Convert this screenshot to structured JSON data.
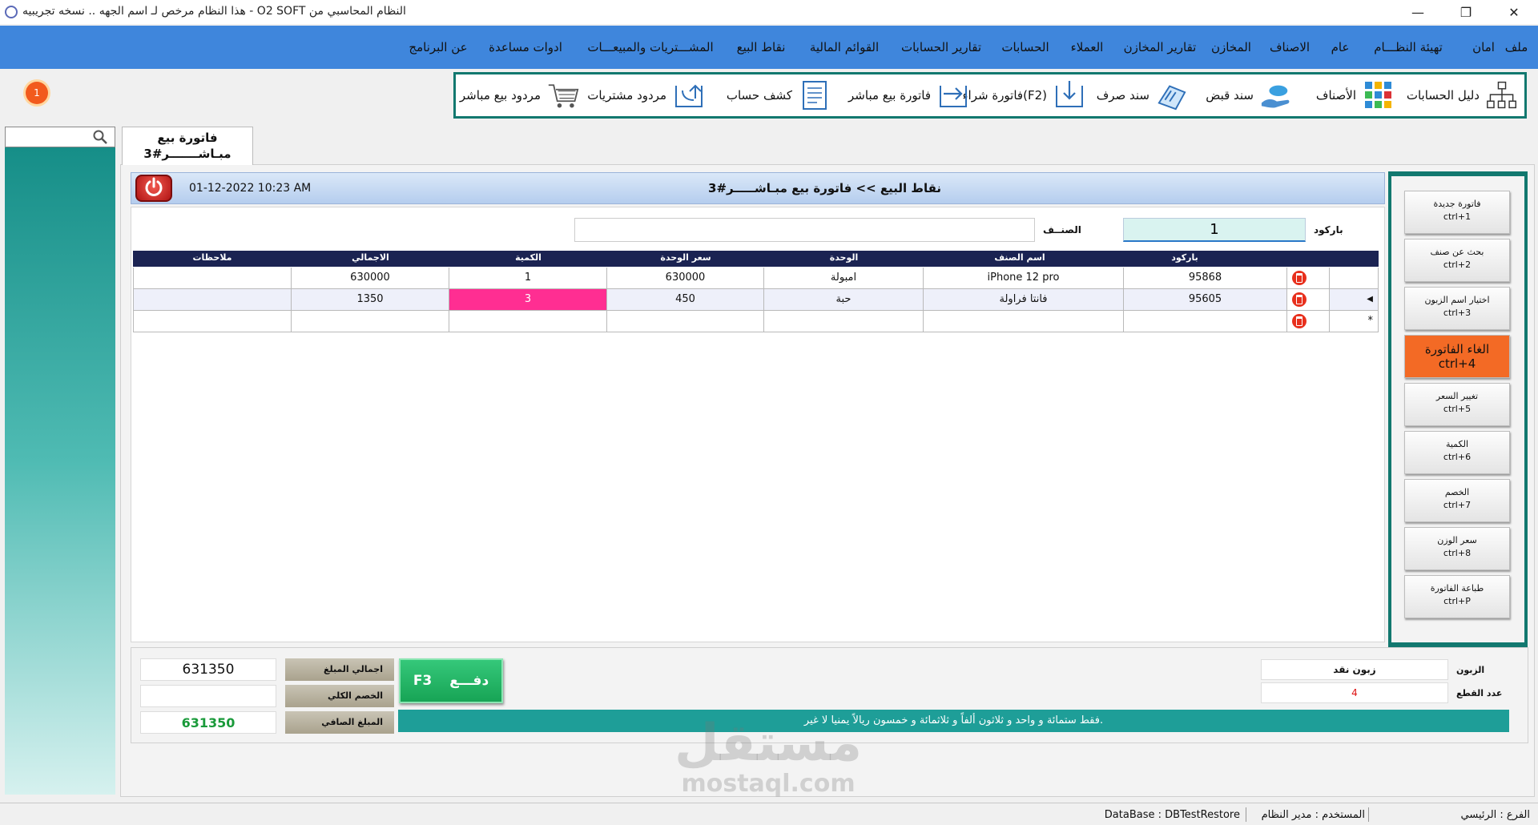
{
  "window": {
    "title": "النظام المحاسبي من O2 SOFT - هذا النظام مرخص لـ اسم الجهه .. نسخه تجريبيه",
    "minimize": "—",
    "restore": "❐",
    "close": "✕"
  },
  "menu": [
    "ملف",
    "امان",
    "تهيئة النظـــام",
    "عام",
    "الاصناف",
    "المخازن",
    "تقارير المخازن",
    "العملاء",
    "الحسابات",
    "تقارير الحسابات",
    "القوائم المالية",
    "نقاط البيع",
    "المشـــتريات والمبيعـــات",
    "ادوات مساعدة",
    "عن البرنامج"
  ],
  "toolbar": [
    {
      "label": "دليل الحسابات",
      "icon": "account-tree-icon"
    },
    {
      "label": "الأصناف",
      "icon": "items-grid-icon"
    },
    {
      "label": "سند قبض",
      "icon": "receipt-hand-icon"
    },
    {
      "label": "سند صرف",
      "icon": "payment-note-icon"
    },
    {
      "label": "فاتورة شراء(F2)",
      "icon": "purchase-invoice-icon"
    },
    {
      "label": "فاتورة بيع مباشر",
      "icon": "sales-invoice-icon"
    },
    {
      "label": "كشف حساب",
      "icon": "statement-icon"
    },
    {
      "label": "مردود مشتريات",
      "icon": "purchase-return-icon"
    },
    {
      "label": "مردود بيع مباشر",
      "icon": "cart-return-icon"
    }
  ],
  "notifications": {
    "count": "1"
  },
  "doc_tab": {
    "line1": "فاتورة  بيع",
    "line2": "مبـاشـــــــر#3"
  },
  "invoice": {
    "datetime": "01-12-2022 10:23 AM",
    "title": "نقاط البيع >> فاتورة بيع مبـاشـــــر#3",
    "barcode_label": "باركود",
    "barcode_value": "1",
    "category_label": "الصنــف",
    "category_value": ""
  },
  "grid": {
    "headers": {
      "barcode": "باركود",
      "item_name": "اسم الصنف",
      "unit": "الوحدة",
      "unit_price": "سعر الوحدة",
      "qty": "الكمية",
      "total": "الاجمالي",
      "notes": "ملاحظات"
    },
    "rows": [
      {
        "marker": "",
        "barcode": "95868",
        "item_name": "iPhone 12 pro",
        "unit": "امبولة",
        "unit_price": "630000",
        "qty": "1",
        "total": "630000",
        "notes": ""
      },
      {
        "marker": "◀",
        "barcode": "95605",
        "item_name": "فانتا فراولة",
        "unit": "حبة",
        "unit_price": "450",
        "qty": "3",
        "total": "1350",
        "notes": ""
      },
      {
        "marker": "*",
        "barcode": "",
        "item_name": "",
        "unit": "",
        "unit_price": "",
        "qty": "",
        "total": "",
        "notes": ""
      }
    ]
  },
  "side_buttons": [
    {
      "label": "فاتورة جديدة",
      "shortcut": "ctrl+1"
    },
    {
      "label": "بحث عن صنف",
      "shortcut": "ctrl+2"
    },
    {
      "label": "اختيار اسم الزبون",
      "shortcut": "ctrl+3"
    },
    {
      "label": "الغاء الفاتورة",
      "shortcut": "ctrl+4"
    },
    {
      "label": "تغيير السعر",
      "shortcut": "ctrl+5"
    },
    {
      "label": "الكمية",
      "shortcut": "ctrl+6"
    },
    {
      "label": "الخصم",
      "shortcut": "ctrl+7"
    },
    {
      "label": "سعر الوزن",
      "shortcut": "ctrl+8"
    },
    {
      "label": "طباعة الفاتورة",
      "shortcut": "ctrl+P"
    }
  ],
  "footer": {
    "total_label": "اجمالي المبلغ",
    "total_value": "631350",
    "discount_label": "الخصم الكلي",
    "discount_value": "",
    "net_label": "المبلغ الصافي",
    "net_value": "631350",
    "pay_label": "دفـــع",
    "pay_key": "F3",
    "amount_words": "فقط ستمائة و واحد و ثلاثون ألفاً و ثلاثمائة و خمسون ريالاً يمنيا لا غير.",
    "customer_label": "الزبون",
    "customer_value": "زبون نقد",
    "pieces_label": "عدد القطع",
    "pieces_value": "4"
  },
  "watermark": {
    "line1": "مستقل",
    "line2": "mostaql.com"
  },
  "status": {
    "branch": "الفرع : الرئيسي",
    "user": "المستخدم : مدير النظام",
    "database": "DataBase : DBTestRestore"
  },
  "colors": {
    "accent": "#3f86dc",
    "teal": "#12786f",
    "qty_highlight": "#ff2e92",
    "cancel": "#f36a25"
  }
}
